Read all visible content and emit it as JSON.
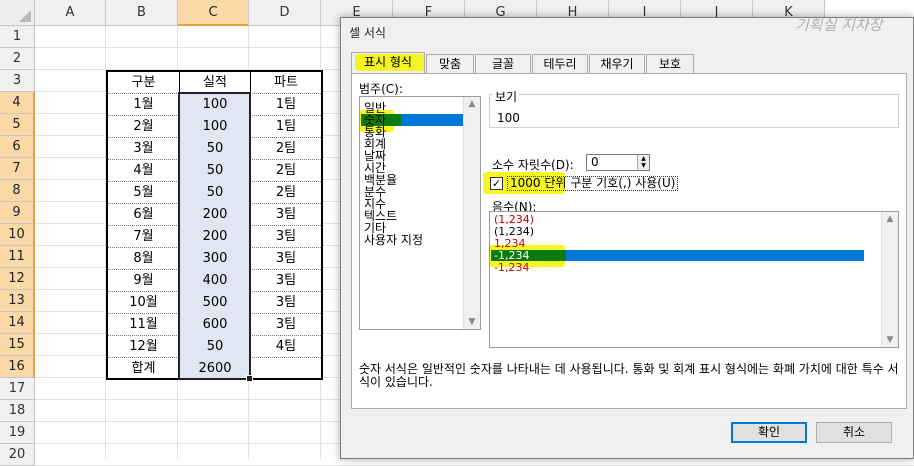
{
  "sheet": {
    "columns": [
      "A",
      "B",
      "C",
      "D",
      "E",
      "F",
      "G",
      "H",
      "I",
      "J",
      "K"
    ],
    "rows": [
      "1",
      "2",
      "3",
      "4",
      "5",
      "6",
      "7",
      "8",
      "9",
      "10",
      "11",
      "12",
      "13",
      "14",
      "15",
      "16",
      "17",
      "18",
      "19",
      "20"
    ],
    "table": {
      "header": [
        "구분",
        "실적",
        "파트"
      ],
      "rows": [
        [
          "1월",
          "100",
          "1팀"
        ],
        [
          "2월",
          "100",
          "1팀"
        ],
        [
          "3월",
          "50",
          "2팀"
        ],
        [
          "4월",
          "50",
          "2팀"
        ],
        [
          "5월",
          "50",
          "2팀"
        ],
        [
          "6월",
          "200",
          "3팀"
        ],
        [
          "7월",
          "200",
          "3팀"
        ],
        [
          "8월",
          "300",
          "3팀"
        ],
        [
          "9월",
          "400",
          "3팀"
        ],
        [
          "10월",
          "500",
          "3팀"
        ],
        [
          "11월",
          "600",
          "3팀"
        ],
        [
          "12월",
          "50",
          "4팀"
        ]
      ],
      "total": [
        "합계",
        "2600",
        ""
      ]
    }
  },
  "watermark": "기획실 지차장",
  "dialog": {
    "title": "셀 서식",
    "tabs": [
      "표시 형식",
      "맞춤",
      "글꼴",
      "테두리",
      "채우기",
      "보호"
    ],
    "category_label": "범주(C):",
    "categories": [
      "일반",
      "숫자",
      "통화",
      "회계",
      "날짜",
      "시간",
      "백분율",
      "분수",
      "지수",
      "텍스트",
      "기타",
      "사용자 지정"
    ],
    "selected_category": "숫자",
    "sample_label": "보기",
    "sample_value": "100",
    "decimal_label": "소수 자릿수(D):",
    "decimal_value": "0",
    "thousands_label": "1000 단위 구분 기호(,) 사용(U)",
    "thousands_checked": true,
    "negative_label": "음수(N):",
    "negative_formats": [
      "(1,234)",
      "(1,234)",
      "1,234",
      "-1,234",
      "-1,234"
    ],
    "selected_negative": "-1,234",
    "description": "숫자 서식은 일반적인 숫자를 나타내는 데 사용됩니다. 통화 및 회계 표시 형식에는 화폐 가치에 대한 특수 서식이 있습니다.",
    "ok_label": "확인",
    "cancel_label": "취소",
    "colors": {
      "selection": "#0078d7",
      "negative_red": "#cc0000",
      "highlight": "#f5f500"
    }
  }
}
